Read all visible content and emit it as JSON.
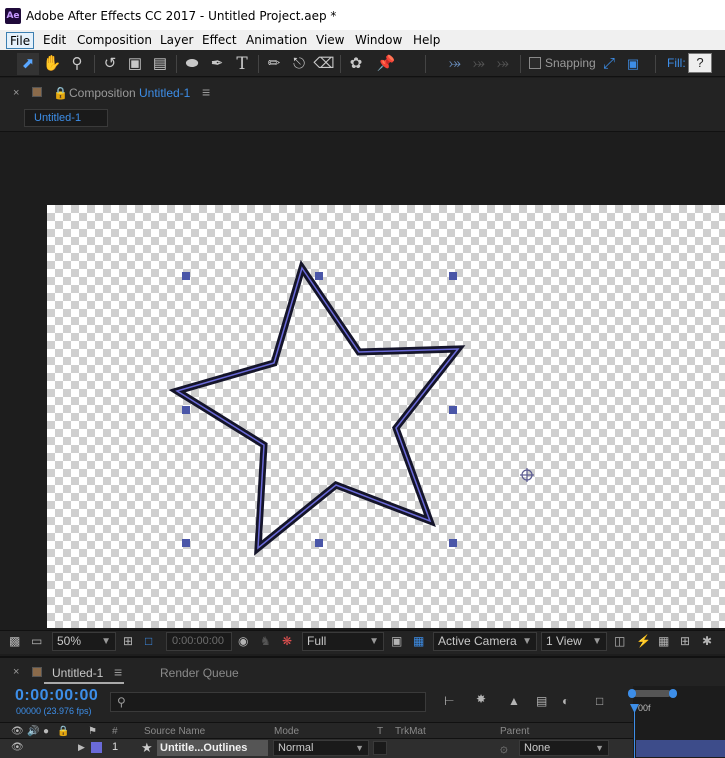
{
  "window": {
    "title": "Adobe After Effects CC 2017 - Untitled Project.aep *",
    "app_icon": "Ae"
  },
  "menu": [
    "File",
    "Edit",
    "Composition",
    "Layer",
    "Effect",
    "Animation",
    "View",
    "Window",
    "Help"
  ],
  "toolbar": {
    "snapping_label": "Snapping",
    "fill_label": "Fill:",
    "fill_value": "?"
  },
  "composition_panel": {
    "panel_prefix": "Composition",
    "name": "Untitled-1",
    "tab_label": "Untitled-1"
  },
  "viewer_controls": {
    "magnification": "50%",
    "timecode": "0:00:00:00",
    "resolution": "Full",
    "camera": "Active Camera",
    "view_layout": "1 View"
  },
  "timeline": {
    "tab_label": "Untitled-1",
    "render_queue_label": "Render Queue",
    "current_time": "0:00:00:00",
    "frame_info": "00000 (23.976 fps)",
    "search_placeholder": "",
    "ruler_label": "00f",
    "columns": {
      "num": "#",
      "source_name": "Source Name",
      "mode": "Mode",
      "t": "T",
      "trkmat": "TrkMat",
      "parent": "Parent"
    },
    "layers": [
      {
        "index": "1",
        "name": "Untitle...Outlines",
        "mode": "Normal",
        "parent": "None",
        "label_color": "#6a6ad8"
      }
    ]
  },
  "colors": {
    "accent_blue": "#3d8ee8",
    "star_outline": "#15152a",
    "star_inner": "#6a6ad8",
    "handle": "#4a56a8"
  }
}
